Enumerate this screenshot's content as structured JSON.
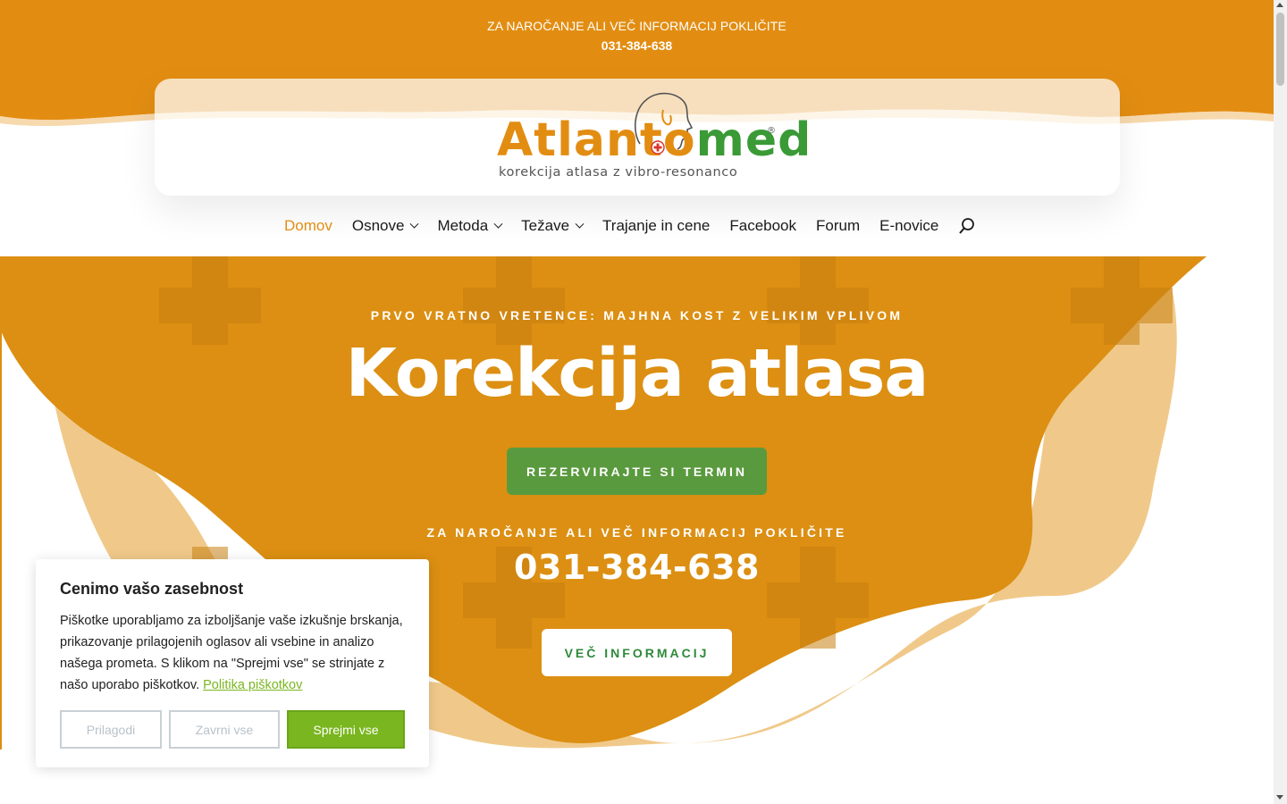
{
  "topbar": {
    "call_label": "ZA NAROČANJE ALI VEČ INFORMACIJ POKLIČITE",
    "phone": "031-384-638"
  },
  "logo": {
    "word_start": "Atlant",
    "word_mid": "o",
    "word_end": "med",
    "registered": "®",
    "tagline": "korekcija atlasa z vibro-resonanco"
  },
  "nav": {
    "items": [
      {
        "label": "Domov",
        "active": true
      },
      {
        "label": "Osnove",
        "dropdown": true
      },
      {
        "label": "Metoda",
        "dropdown": true
      },
      {
        "label": "Težave",
        "dropdown": true
      },
      {
        "label": "Trajanje in cene"
      },
      {
        "label": "Facebook"
      },
      {
        "label": "Forum"
      },
      {
        "label": "E-novice"
      }
    ],
    "search_icon": "search-icon"
  },
  "hero": {
    "subtitle": "PRVO VRATNO VRETENCE: MAJHNA KOST Z VELIKIM VPLIVOM",
    "title": "Korekcija atlasa",
    "book_button": "REZERVIRAJTE SI TERMIN",
    "call_label": "ZA NAROČANJE ALI VEČ INFORMACIJ POKLIČITE",
    "phone": "031-384-638",
    "more_button": "VEČ INFORMACIJ"
  },
  "cookie": {
    "title": "Cenimo vašo zasebnost",
    "text": "Piškotke uporabljamo za izboljšanje vaše izkušnje brskanja, prikazovanje prilagojenih oglasov ali vsebine in analizo našega prometa. S klikom na \"Sprejmi vse\" se strinjate z našo uporabo piškotkov.",
    "policy_link": "Politika piškotkov",
    "customize_button": "Prilagodi",
    "reject_button": "Zavrni vse",
    "accept_button": "Sprejmi vse"
  },
  "colors": {
    "brand_orange": "#e28d12",
    "hero_orange": "#dc8f12",
    "hero_light": "#f0c98a",
    "brand_green": "#5a9a3e",
    "cookie_green": "#7ab61f"
  }
}
